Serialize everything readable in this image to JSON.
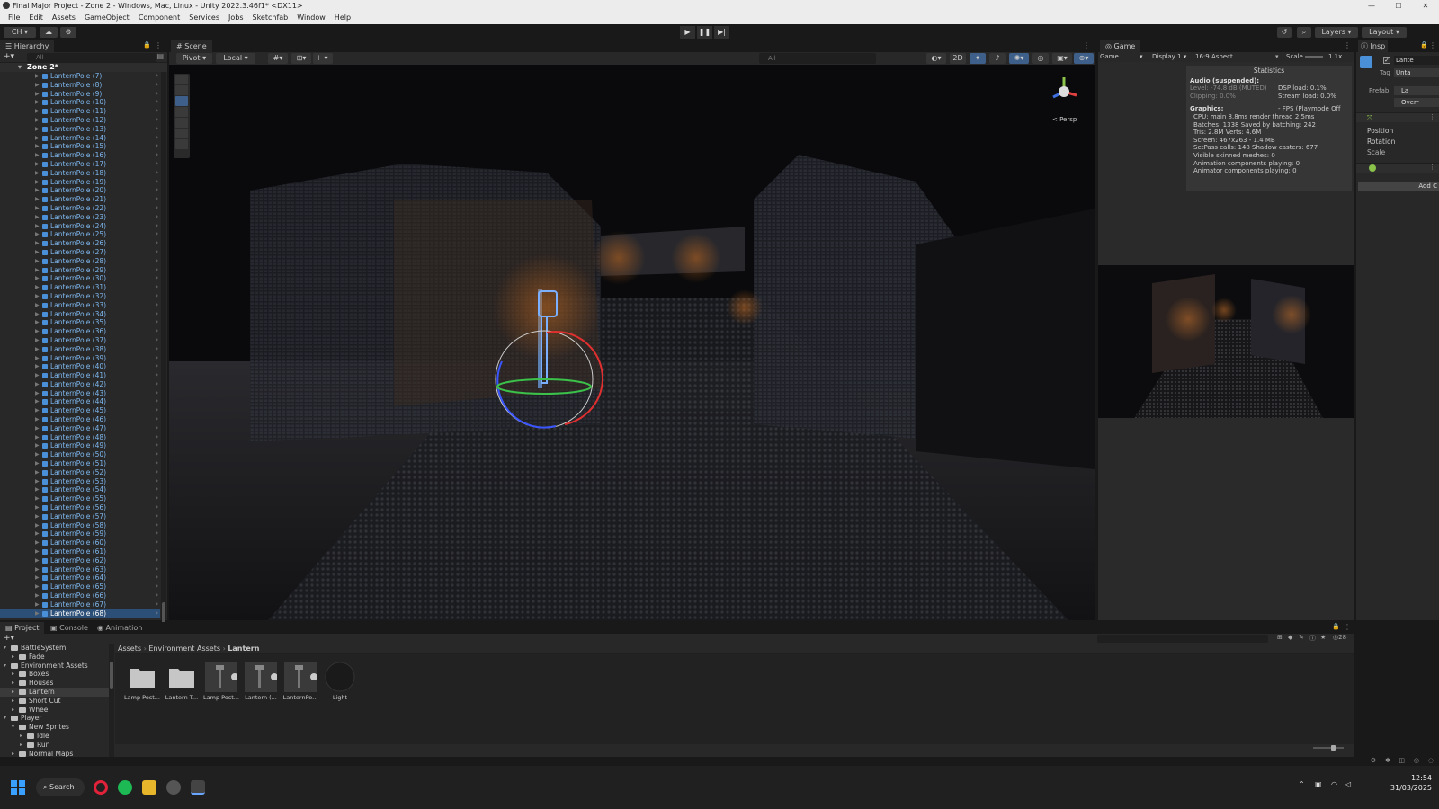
{
  "window": {
    "title": "Final Major Project - Zone 2 - Windows, Mac, Linux - Unity 2022.3.46f1* <DX11>"
  },
  "menu": [
    "File",
    "Edit",
    "Assets",
    "GameObject",
    "Component",
    "Services",
    "Jobs",
    "Sketchfab",
    "Window",
    "Help"
  ],
  "toolbar": {
    "account": "CH",
    "layers": "Layers",
    "layout": "Layout"
  },
  "hierarchy": {
    "tab": "Hierarchy",
    "search_placeholder": "All",
    "scene": "Zone 2*",
    "items": [
      "LanternPole (7)",
      "LanternPole (8)",
      "LanternPole (9)",
      "LanternPole (10)",
      "LanternPole (11)",
      "LanternPole (12)",
      "LanternPole (13)",
      "LanternPole (14)",
      "LanternPole (15)",
      "LanternPole (16)",
      "LanternPole (17)",
      "LanternPole (18)",
      "LanternPole (19)",
      "LanternPole (20)",
      "LanternPole (21)",
      "LanternPole (22)",
      "LanternPole (23)",
      "LanternPole (24)",
      "LanternPole (25)",
      "LanternPole (26)",
      "LanternPole (27)",
      "LanternPole (28)",
      "LanternPole (29)",
      "LanternPole (30)",
      "LanternPole (31)",
      "LanternPole (32)",
      "LanternPole (33)",
      "LanternPole (34)",
      "LanternPole (35)",
      "LanternPole (36)",
      "LanternPole (37)",
      "LanternPole (38)",
      "LanternPole (39)",
      "LanternPole (40)",
      "LanternPole (41)",
      "LanternPole (42)",
      "LanternPole (43)",
      "LanternPole (44)",
      "LanternPole (45)",
      "LanternPole (46)",
      "LanternPole (47)",
      "LanternPole (48)",
      "LanternPole (49)",
      "LanternPole (50)",
      "LanternPole (51)",
      "LanternPole (52)",
      "LanternPole (53)",
      "LanternPole (54)",
      "LanternPole (55)",
      "LanternPole (56)",
      "LanternPole (57)",
      "LanternPole (58)",
      "LanternPole (59)",
      "LanternPole (60)",
      "LanternPole (61)",
      "LanternPole (62)",
      "LanternPole (63)",
      "LanternPole (64)",
      "LanternPole (65)",
      "LanternPole (66)",
      "LanternPole (67)",
      "LanternPole (68)"
    ]
  },
  "scene": {
    "tab": "Scene",
    "pivot": "Pivot",
    "local": "Local",
    "search_placeholder": "All",
    "mode_2d": "2D",
    "persp": "< Persp"
  },
  "game": {
    "tab": "Game",
    "mode": "Game",
    "display": "Display 1",
    "aspect": "16:9 Aspect",
    "scale_label": "Scale",
    "scale_value": "1.1x",
    "stats": {
      "title": "Statistics",
      "audio_header": "Audio (suspended):",
      "level": "Level: -74.8 dB (MUTED)",
      "clipping": "Clipping: 0.0%",
      "dsp": "DSP load: 0.1%",
      "stream": "Stream load: 0.0%",
      "graphics_header": "Graphics:",
      "fps": "- FPS (Playmode Off",
      "cpu": "CPU: main 8.8ms  render thread 2.5ms",
      "batches": "Batches: 1338   Saved by batching: 242",
      "tris": "Tris: 2.8M        Verts: 4.6M",
      "screen": "Screen: 467x263 - 1.4 MB",
      "setpass": "SetPass calls: 148     Shadow casters: 677",
      "skinned": "Visible skinned meshes: 0",
      "anim_components": "Animation components playing: 0",
      "animator_components": "Animator components playing: 0"
    }
  },
  "inspector": {
    "tab": "Insp",
    "name": "Lante",
    "tag_label": "Tag",
    "tag_value": "Unta",
    "prefab_label": "Prefab",
    "prefab_value": "La",
    "overrides": "Overr",
    "position": "Position",
    "rotation": "Rotation",
    "scale": "Scale",
    "add_component": "Add C"
  },
  "project": {
    "tabs": [
      "Project",
      "Console",
      "Animation"
    ],
    "tree": [
      {
        "label": "BattleSystem",
        "depth": 1,
        "open": true
      },
      {
        "label": "Fade",
        "depth": 2,
        "open": false
      },
      {
        "label": "Environment Assets",
        "depth": 1,
        "open": true
      },
      {
        "label": "Boxes",
        "depth": 2,
        "open": false
      },
      {
        "label": "Houses",
        "depth": 2,
        "open": false
      },
      {
        "label": "Lantern",
        "depth": 2,
        "open": false
      },
      {
        "label": "Short Cut",
        "depth": 2,
        "open": false
      },
      {
        "label": "Wheel",
        "depth": 2,
        "open": false
      },
      {
        "label": "Player",
        "depth": 1,
        "open": true
      },
      {
        "label": "New Sprites",
        "depth": 2,
        "open": true
      },
      {
        "label": "Idle",
        "depth": 3,
        "open": false
      },
      {
        "label": "Run",
        "depth": 3,
        "open": false
      },
      {
        "label": "Normal Maps",
        "depth": 2,
        "open": false
      }
    ],
    "breadcrumb": [
      "Assets",
      "Environment Assets",
      "Lantern"
    ],
    "assets": [
      {
        "label": "Lamp Post...",
        "kind": "folder"
      },
      {
        "label": "Lantern T...",
        "kind": "folder"
      },
      {
        "label": "Lamp Post...",
        "kind": "prefab"
      },
      {
        "label": "Lantern (...",
        "kind": "prefab"
      },
      {
        "label": "LanternPo...",
        "kind": "prefab"
      },
      {
        "label": "Light",
        "kind": "material"
      }
    ],
    "count": "28"
  },
  "taskbar": {
    "search": "Search",
    "time": "12:54",
    "date": "31/03/2025"
  },
  "colors": {
    "accent": "#3e5f8a",
    "hier_text": "#7fb8ef",
    "selected": "#2c4f78"
  }
}
